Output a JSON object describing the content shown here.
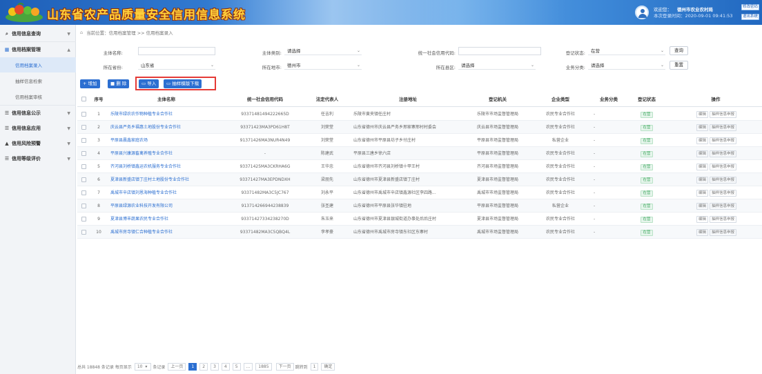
{
  "header": {
    "title": "山东省农产品质量安全信用信息系统",
    "welcome_label": "欢迎您：",
    "org_name": "德州市农业农村局",
    "login_time_label": "本次登录时间：2020-09-01 09:41:53",
    "btn_change_password": "修改密码",
    "btn_logout": "退出系统"
  },
  "sidebar": {
    "items": [
      {
        "icon": "search-icon",
        "label": "信用信息查询",
        "expanded": false
      },
      {
        "icon": "grid-icon",
        "label": "信用档案管理",
        "expanded": true
      },
      {
        "icon": "list-icon",
        "label": "信用信息公示",
        "expanded": false
      },
      {
        "icon": "list-icon",
        "label": "信用信息应用",
        "expanded": false
      },
      {
        "icon": "warning-icon",
        "label": "信用风险预警",
        "expanded": false
      },
      {
        "icon": "list-icon",
        "label": "信用等级评价",
        "expanded": false
      }
    ],
    "subitems": [
      {
        "label": "信用档案录入",
        "active": true
      },
      {
        "label": "抽样信息检索",
        "active": false
      },
      {
        "label": "信用档案审核",
        "active": false
      }
    ]
  },
  "breadcrumb": "当前位置：信用档案管理 >> 信用档案录入",
  "search_form": {
    "subject_name_label": "主体名称:",
    "subject_name_value": "",
    "subject_type_label": "主体类别:",
    "subject_type_value": "请选择",
    "credit_code_label": "统一社会信用代码:",
    "credit_code_value": "",
    "reg_status_label": "登记状态:",
    "reg_status_value": "在营",
    "province_label": "所在省份:",
    "province_value": "山东省",
    "city_label": "所在地市:",
    "city_value": "德州市",
    "county_label": "所在县区:",
    "county_value": "请选择",
    "biz_category_label": "业务分类:",
    "biz_category_value": "请选择",
    "btn_query": "查询",
    "btn_reset": "重置"
  },
  "toolbar": {
    "add": "+ 增加",
    "delete": "删 除",
    "import": "导入",
    "template_download": "抽样模版下载"
  },
  "table": {
    "columns": [
      "序号",
      "主体名称",
      "统一社会信用代码",
      "法定代表人",
      "注册地址",
      "登记机关",
      "企业类型",
      "业务分类",
      "登记状态",
      "操作"
    ],
    "op_edit": "编辑",
    "op_sample": "抽样信息申报",
    "rows": [
      {
        "no": "1",
        "name": "乐陵市绿农农作物种植专业合作社",
        "code": "93371481494222665D",
        "rep": "任吉利",
        "addr": "乐陵市黄夹镇任庄村",
        "authority": "乐陵市市场监督管理局",
        "type": "农民专业合作社",
        "biz": "-",
        "status": "在营"
      },
      {
        "no": "2",
        "name": "庆云县严务乡福惠土地股份专业合作社",
        "code": "93371423MA3PD61H8T",
        "rep": "刘荣堂",
        "addr": "山东省德州市庆云县严务乡邢家寨邢村村委会",
        "authority": "庆云县市场监督管理局",
        "type": "农民专业合作社",
        "biz": "-",
        "status": "在营"
      },
      {
        "no": "3",
        "name": "平原县晨鑫家庭农场",
        "code": "91371426MA3NUR4N49",
        "rep": "刘荣堂",
        "addr": "山东省德州市平原县坊子乡付庄村",
        "authority": "平原县市场监督管理局",
        "type": "私营企业",
        "biz": "-",
        "status": "在营"
      },
      {
        "no": "4",
        "name": "平原县兴康源畜禽养殖专业合作社",
        "code": "-",
        "rep": "陈建武",
        "addr": "平原县三唐乡徐六店",
        "authority": "平原县市场监督管理局",
        "type": "农民专业合作社",
        "biz": "-",
        "status": "在营"
      },
      {
        "no": "5",
        "name": "齐河县刘桥镇鑫运农机服务专业合作社",
        "code": "93371425MA3CKRHA6G",
        "rep": "王华忠",
        "addr": "山东省德州市齐河县刘桥镇十甲王村",
        "authority": "齐河县市场监督管理局",
        "type": "农民专业合作社",
        "biz": "-",
        "status": "在营"
      },
      {
        "no": "6",
        "name": "夏津县新盛店镇丁庄村土地股份专业合作社",
        "code": "93371427MA3EPDNDXH",
        "rep": "梁朋先",
        "addr": "山东省德州市夏津县新盛店镇丁庄村",
        "authority": "夏津县市场监督管理局",
        "type": "农民专业合作社",
        "biz": "-",
        "status": "在营"
      },
      {
        "no": "7",
        "name": "禹城市辛店镇刘恩海种植专业合作社",
        "code": "93371482MA3C5JC767",
        "rep": "刘永平",
        "addr": "山东省德州市禹城市辛店镇鑫源社区李四路...",
        "authority": "禹城市市场监督管理局",
        "type": "农民专业合作社",
        "biz": "-",
        "status": "在营"
      },
      {
        "no": "8",
        "name": "平原县绿源农业科技开发有限公司",
        "code": "913714266944238839",
        "rep": "张圣建",
        "addr": "山东省德州市平原县张华镇驻地",
        "authority": "平原县市场监督管理局",
        "type": "私营企业",
        "biz": "-",
        "status": "在营"
      },
      {
        "no": "9",
        "name": "夏津县博丰蔬果农民专业合作社",
        "code": "93371427334238270D",
        "rep": "朱玉来",
        "addr": "山东省德州市夏津县银城街道办事处后后庄村",
        "authority": "夏津县市场监督管理局",
        "type": "农民专业合作社",
        "biz": "-",
        "status": "在营"
      },
      {
        "no": "10",
        "name": "禹城市房寺镇仁合种植专业合作社",
        "code": "93371482MA3C5QBQ4L",
        "rep": "李孝豪",
        "addr": "山东省德州市禹城市房寺镇东社区东寨村",
        "authority": "禹城市市场监督管理局",
        "type": "农民专业合作社",
        "biz": "-",
        "status": "在营"
      }
    ]
  },
  "pager": {
    "total_text": "总共 18848 条记录 每页显示",
    "page_size": "10",
    "unit": "条记录",
    "prev": "上一页",
    "pages": [
      "1",
      "2",
      "3",
      "4",
      "5",
      "...",
      "1885"
    ],
    "current_page": "1",
    "next": "下一页",
    "jump_label": "跳转到",
    "jump_value": "1",
    "confirm": "确定"
  },
  "colors": {
    "header_blue": "#2a73cc",
    "accent": "#2c6fd1",
    "highlight_box": "#e53935",
    "status_green": "#3aa55b"
  }
}
